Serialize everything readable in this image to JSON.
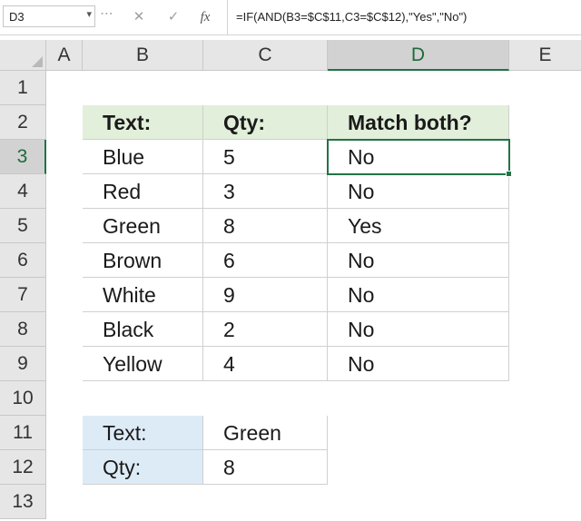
{
  "formula_bar": {
    "name_box": "D3",
    "cancel_glyph": "✕",
    "enter_glyph": "✓",
    "fx_label": "fx",
    "formula": "=IF(AND(B3=$C$11,C3=$C$12),\"Yes\",\"No\")"
  },
  "columns": [
    "A",
    "B",
    "C",
    "D",
    "E"
  ],
  "rows": [
    "1",
    "2",
    "3",
    "4",
    "5",
    "6",
    "7",
    "8",
    "9",
    "10",
    "11",
    "12",
    "13"
  ],
  "selection": {
    "column": "D",
    "row": "3"
  },
  "table": {
    "headers": [
      "Text:",
      "Qty:",
      "Match both?"
    ],
    "rows": [
      [
        "Blue",
        "5",
        "No"
      ],
      [
        "Red",
        "3",
        "No"
      ],
      [
        "Green",
        "8",
        "Yes"
      ],
      [
        "Brown",
        "6",
        "No"
      ],
      [
        "White",
        "9",
        "No"
      ],
      [
        "Black",
        "2",
        "No"
      ],
      [
        "Yellow",
        "4",
        "No"
      ]
    ]
  },
  "criteria": [
    {
      "label": "Text:",
      "value": "Green"
    },
    {
      "label": "Qty:",
      "value": "8"
    }
  ],
  "colors": {
    "header_green": "#e2efda",
    "criteria_blue": "#ddebf7",
    "selection_green": "#217346"
  }
}
